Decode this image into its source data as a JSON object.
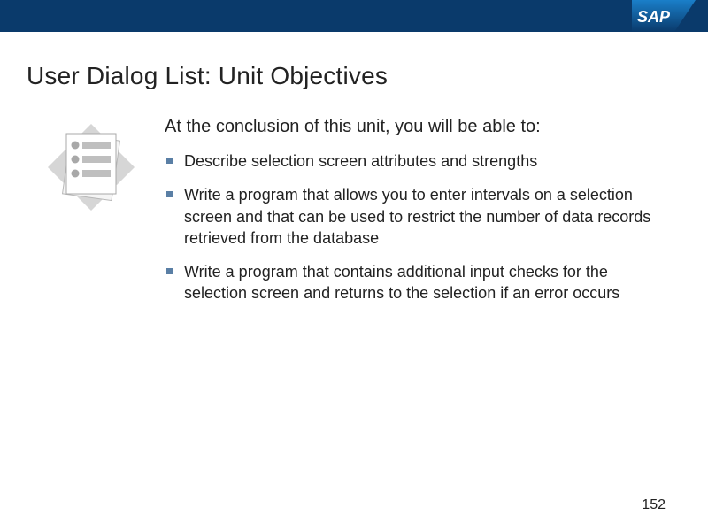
{
  "header": {
    "logo_label": "SAP"
  },
  "slide": {
    "title": "User Dialog List: Unit Objectives",
    "intro": "At the conclusion of this unit, you will be able to:",
    "bullets": [
      "Describe selection screen attributes and strengths",
      "Write a program that allows you to enter intervals on a selection screen and that can be used to restrict the number of data records retrieved from the database",
      "Write a program that contains additional input checks for the selection screen and returns to the selection if an error occurs"
    ],
    "page_number": "152"
  }
}
